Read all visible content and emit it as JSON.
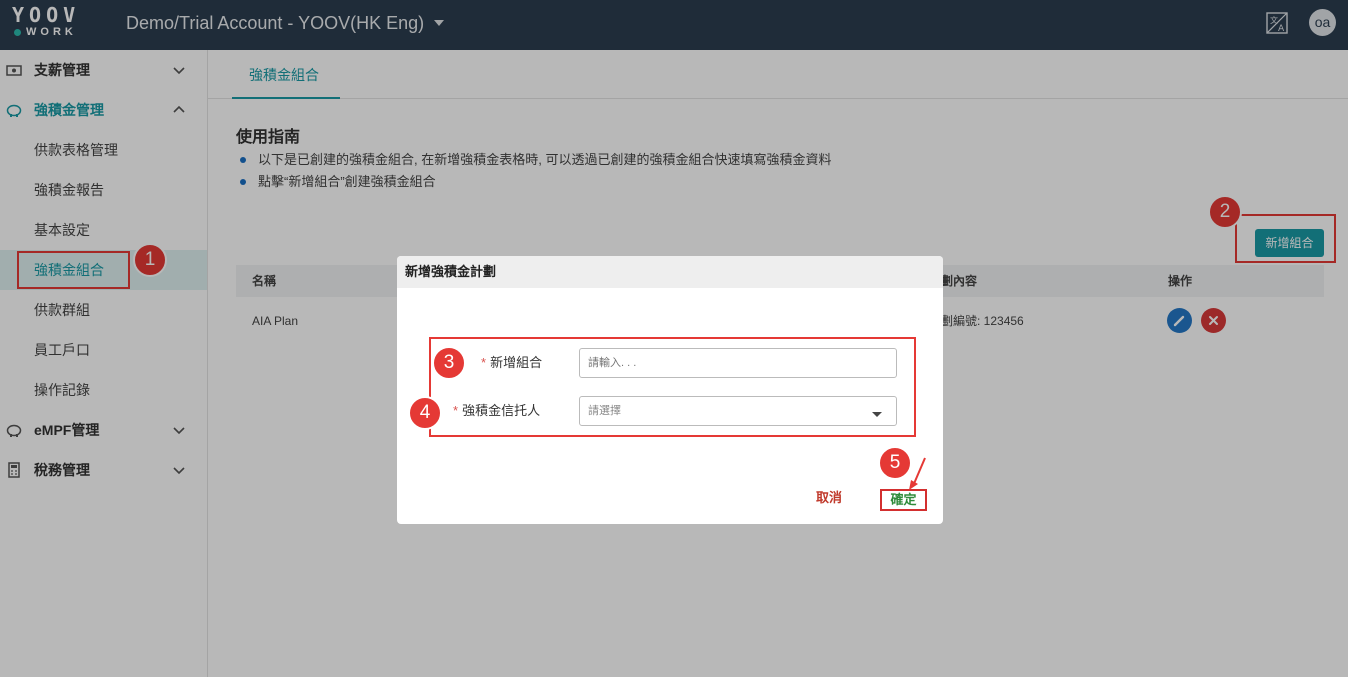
{
  "app": {
    "logo_text": "YOOV",
    "logo_subtext": "WORK",
    "account_title": "Demo/Trial Account - YOOV(HK Eng)",
    "avatar_initials": "oa"
  },
  "sidebar": {
    "items": [
      {
        "label": "支薪管理",
        "icon": "payroll-icon",
        "expanded": false
      },
      {
        "label": "強積金管理",
        "icon": "piggy-bank-icon",
        "expanded": true
      },
      {
        "label": "eMPF管理",
        "icon": "piggy-bank-icon",
        "expanded": false
      },
      {
        "label": "稅務管理",
        "icon": "calculator-icon",
        "expanded": false
      }
    ],
    "subitems": [
      {
        "label": "供款表格管理"
      },
      {
        "label": "強積金報告"
      },
      {
        "label": "基本設定"
      },
      {
        "label": "強積金組合",
        "active": true
      },
      {
        "label": "供款群組"
      },
      {
        "label": "員工戶口"
      },
      {
        "label": "操作記錄"
      }
    ]
  },
  "main": {
    "tab_label": "強積金組合",
    "guide": {
      "title": "使用指南",
      "lines": [
        "以下是已創建的強積金組合, 在新增強積金表格時, 可以透過已創建的強積金組合快速填寫強積金資料",
        "點擊“新增組合”創建強積金組合"
      ]
    },
    "add_button_label": "新增組合",
    "table": {
      "headers": [
        "名稱",
        "劃內容",
        "操作"
      ],
      "rows": [
        {
          "name": "AIA Plan",
          "content": "劃編號: 123456"
        }
      ]
    }
  },
  "modal": {
    "title": "新增強積金計劃",
    "fields": [
      {
        "label": "新增組合",
        "required_mark": "*",
        "placeholder": "請輸入. . ."
      },
      {
        "label": "強積金信托人",
        "required_mark": "*",
        "value": "請選擇"
      }
    ],
    "cancel_label": "取消",
    "confirm_label": "確定"
  },
  "annotations": {
    "steps": [
      "1",
      "2",
      "3",
      "4",
      "5"
    ],
    "color": "#e53935"
  },
  "colors": {
    "topbar": "#2c3e50",
    "accent": "#1a9aa5"
  }
}
